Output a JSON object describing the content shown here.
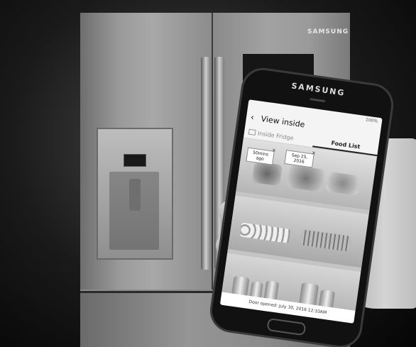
{
  "fridge": {
    "brand": "SAMSUNG"
  },
  "phone": {
    "brand": "SAMSUNG",
    "status": "100%",
    "app": {
      "title": "View inside",
      "tabs": [
        {
          "label": "Inside Fridge",
          "active": false
        },
        {
          "label": "Food List",
          "active": true
        }
      ],
      "tags": [
        {
          "text": "50mins ago"
        },
        {
          "text": "Sep 25, 2016"
        }
      ],
      "footer": "Door opened: July 30, 2016 12:10AM"
    }
  },
  "icons": [
    "back-arrow-icon",
    "camera-icon",
    "close-icon"
  ]
}
